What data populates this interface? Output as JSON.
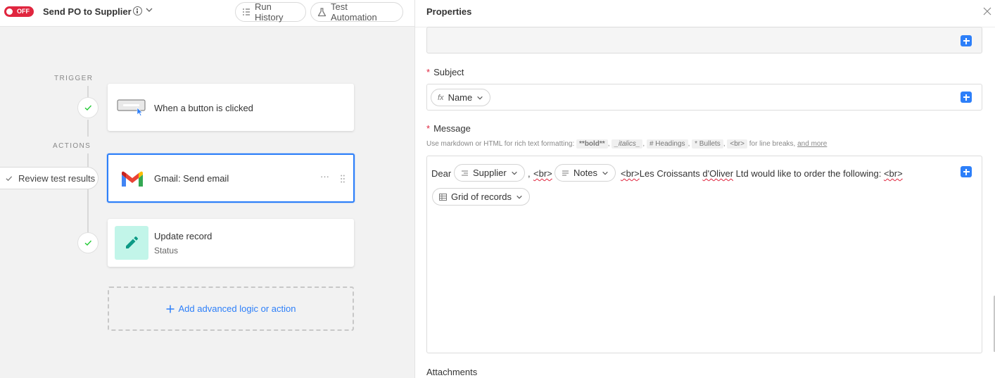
{
  "header": {
    "toggle_label": "OFF",
    "workflow_title": "Send PO to Supplier",
    "run_history_label": "Run History",
    "test_automation_label": "Test Automation"
  },
  "canvas": {
    "trigger_label": "TRIGGER",
    "actions_label": "ACTIONS",
    "trigger_card": {
      "title": "When a button is clicked"
    },
    "review_label": "Review test results",
    "gmail_card": {
      "title": "Gmail: Send email",
      "more": "···"
    },
    "update_card": {
      "title": "Update record",
      "subtitle": "Status"
    },
    "add_label": "Add advanced logic or action"
  },
  "properties": {
    "title": "Properties",
    "subject_label": "Subject",
    "subject_token": "Name",
    "message_label": "Message",
    "hint_prefix": "Use markdown or HTML for rich text formatting:",
    "hint_bold": "**bold**",
    "hint_italics": "_italics_",
    "hint_headings": "# Headings",
    "hint_bullets": "* Bullets",
    "hint_br": "<br>",
    "hint_suffix": "for line breaks,",
    "hint_more": "and more",
    "message": {
      "dear": "Dear",
      "supplier_token": "Supplier",
      "comma": ",",
      "br1": "<br>",
      "notes_token": "Notes",
      "br2": "<br>",
      "company": "Les Croissants",
      "company2": "d'Oliver",
      "rest": "Ltd would like to order the following:",
      "br3": "<br>",
      "grid_token": "Grid of records"
    },
    "attachments_label": "Attachments"
  },
  "colors": {
    "accent": "#2d7ff9",
    "toggle_off": "#e0263f",
    "check_green": "#20c933",
    "edit_icon_bg": "#c2f5e9",
    "edit_icon_fg": "#0c9a85"
  }
}
